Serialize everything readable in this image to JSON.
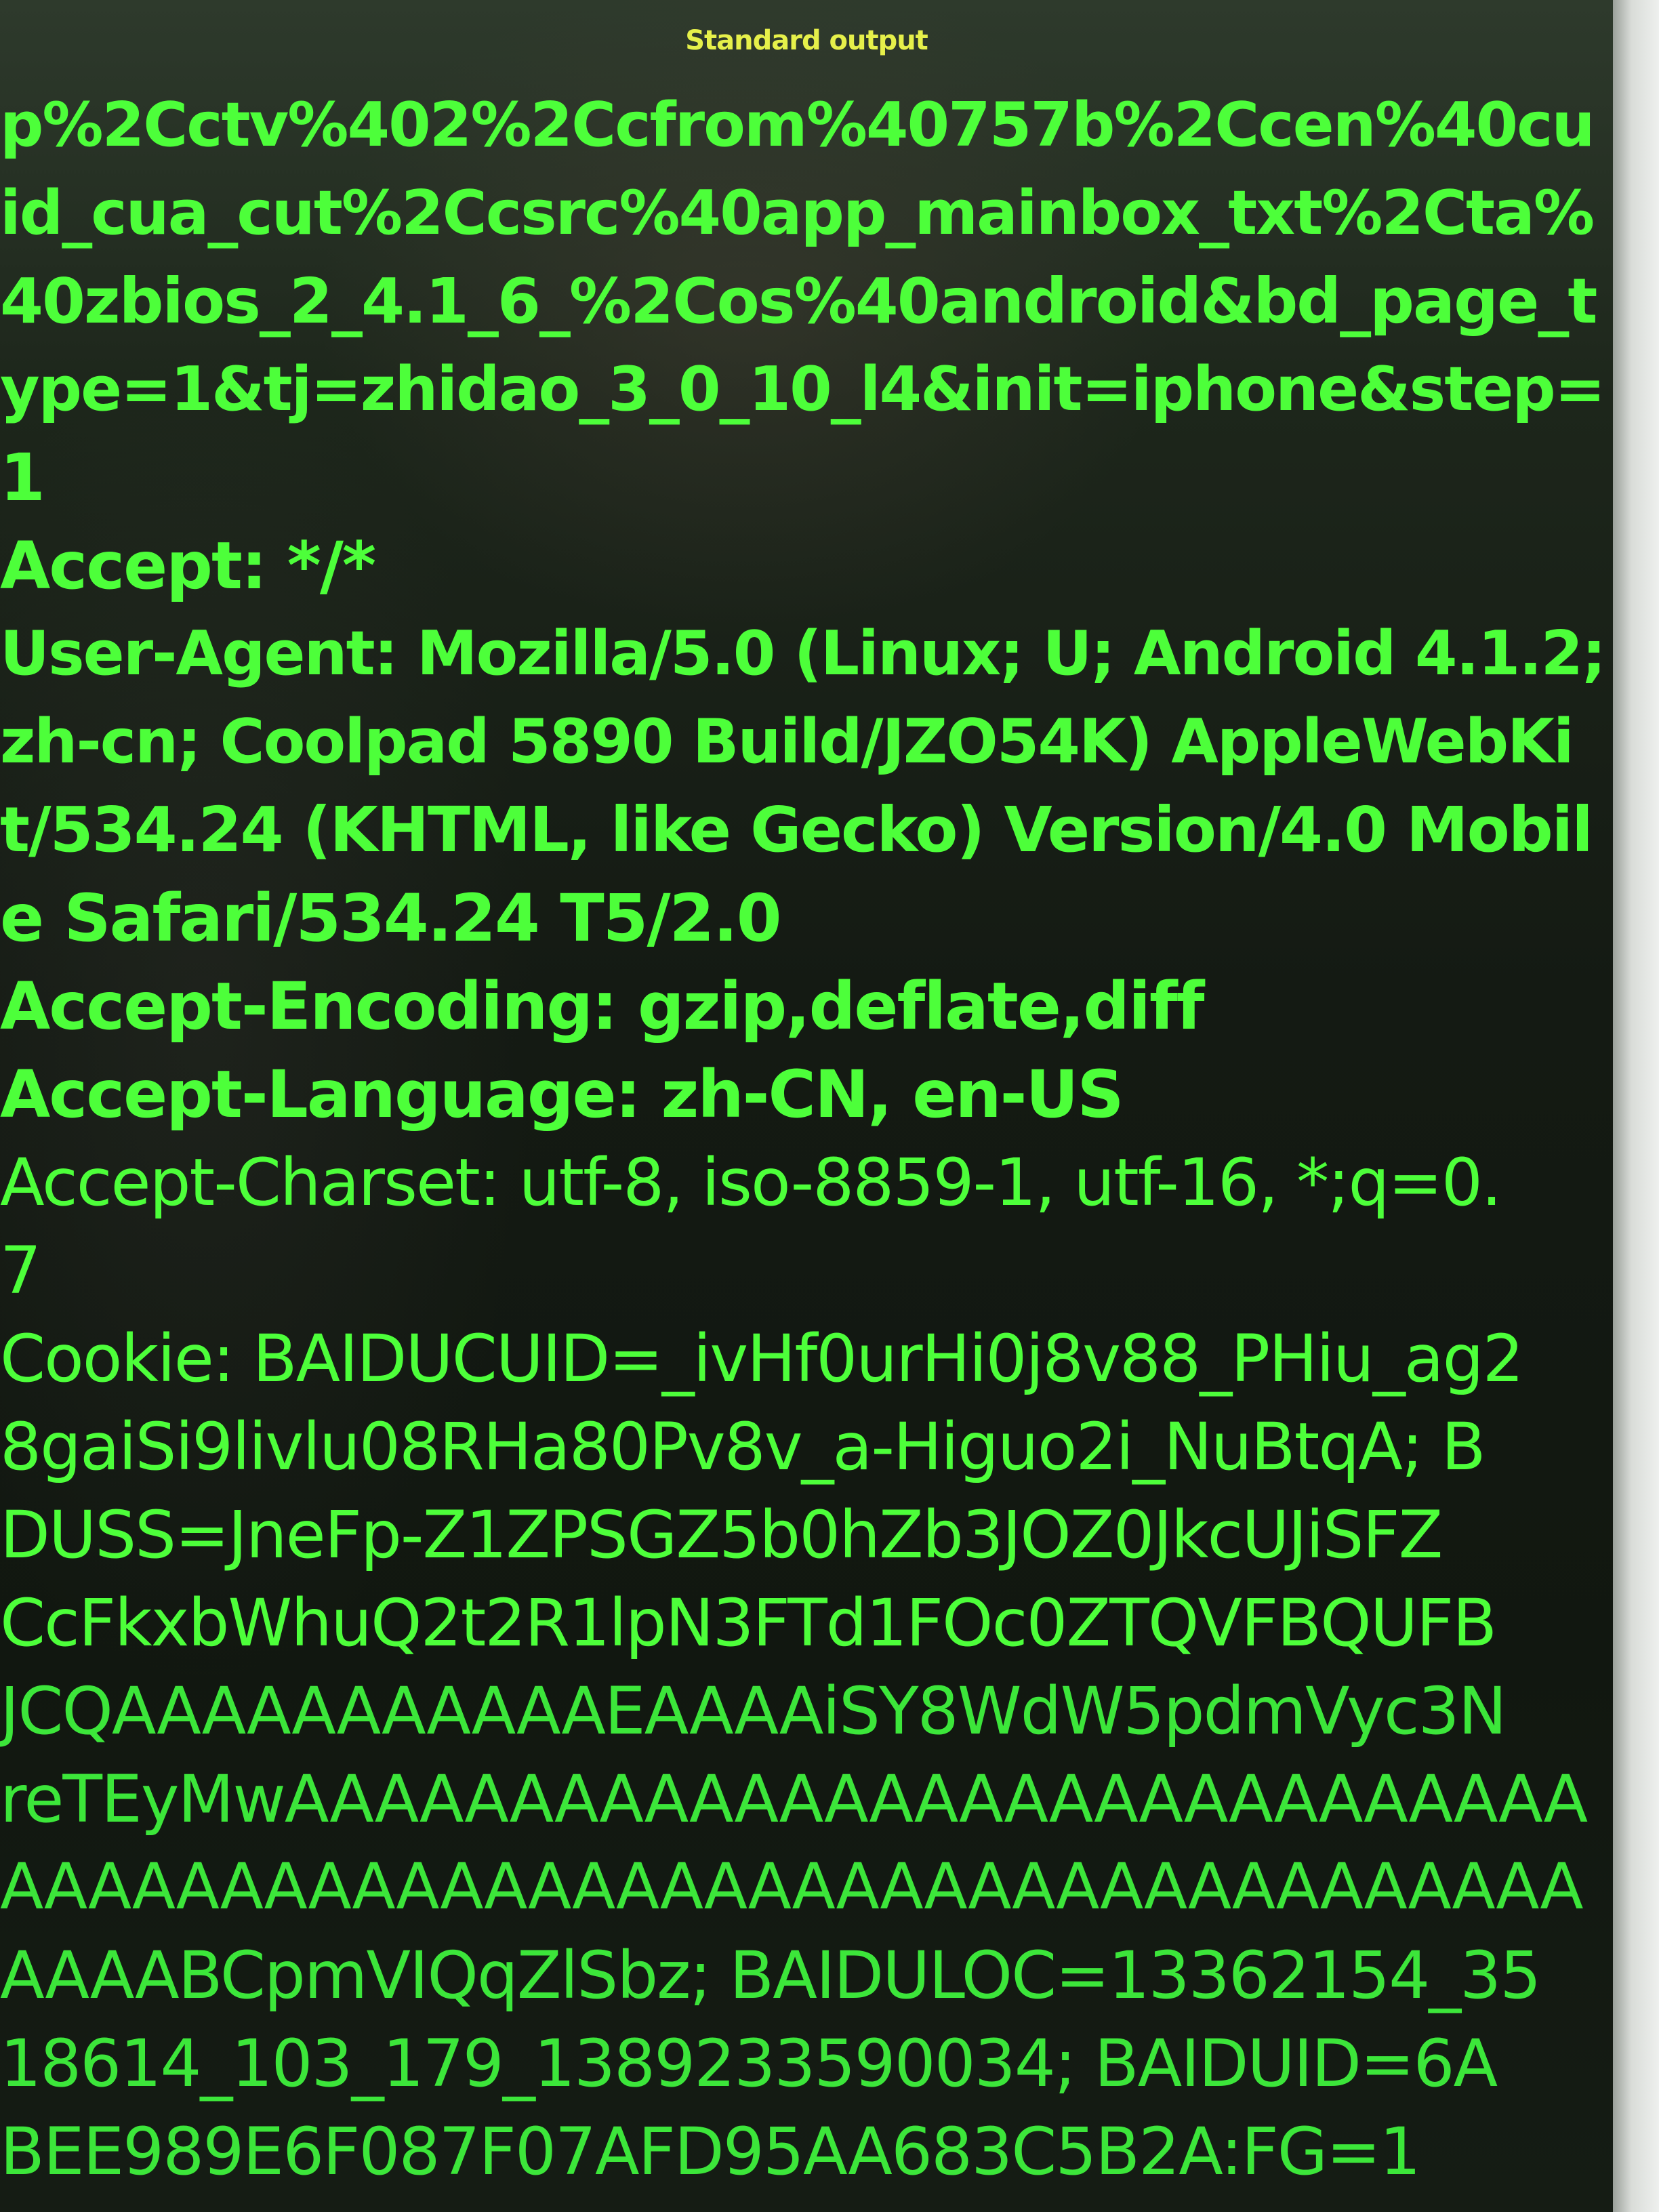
{
  "window": {
    "title": "Standard output"
  },
  "output_lines": [
    "p%2Cctv%402%2Ccfrom%40757b%2Ccen%40cu",
    "id_cua_cut%2Ccsrc%40app_mainbox_txt%2Cta%",
    "40zbios_2_4.1_6_%2Cos%40android&bd_page_t",
    "ype=1&tj=zhidao_3_0_10_l4&init=iphone&step=",
    "1",
    "Accept: */*",
    "User-Agent: Mozilla/5.0 (Linux; U; Android 4.1.2;",
    "zh-cn; Coolpad 5890 Build/JZO54K) AppleWebKi",
    "t/534.24 (KHTML, like Gecko) Version/4.0 Mobil",
    "e Safari/534.24 T5/2.0",
    "Accept-Encoding: gzip,deflate,diff",
    "Accept-Language: zh-CN, en-US",
    "Accept-Charset: utf-8, iso-8859-1, utf-16, *;q=0.",
    "7",
    "Cookie: BAIDUCUID=_ivHf0urHi0j8v88_PHiu_ag2",
    "8gaiSi9livlu08RHa80Pv8v_a-Higuo2i_NuBtqA; B",
    "DUSS=JneFp-Z1ZPSGZ5b0hZb3JOZ0JkcUJiSFZ",
    "CcFkxbWhuQ2t2R1lpN3FTd1FOc0ZTQVFBQUFB",
    "JCQAAAAAAAAAAAEAAAAiSY8WdW5pdmVyc3N",
    "reTEyMwAAAAAAAAAAAAAAAAAAAAAAAAAAAAA",
    "AAAAAAAAAAAAAAAAAAAAAAAAAAAAAAAAAAAA",
    "AAAABCpmVIQqZlSbz; BAIDULOC=13362154_35",
    "18614_103_179_1389233590034; BAIDUID=6A",
    "BEE989E6F087F07AFD95AA683C5B2A:FG=1"
  ]
}
